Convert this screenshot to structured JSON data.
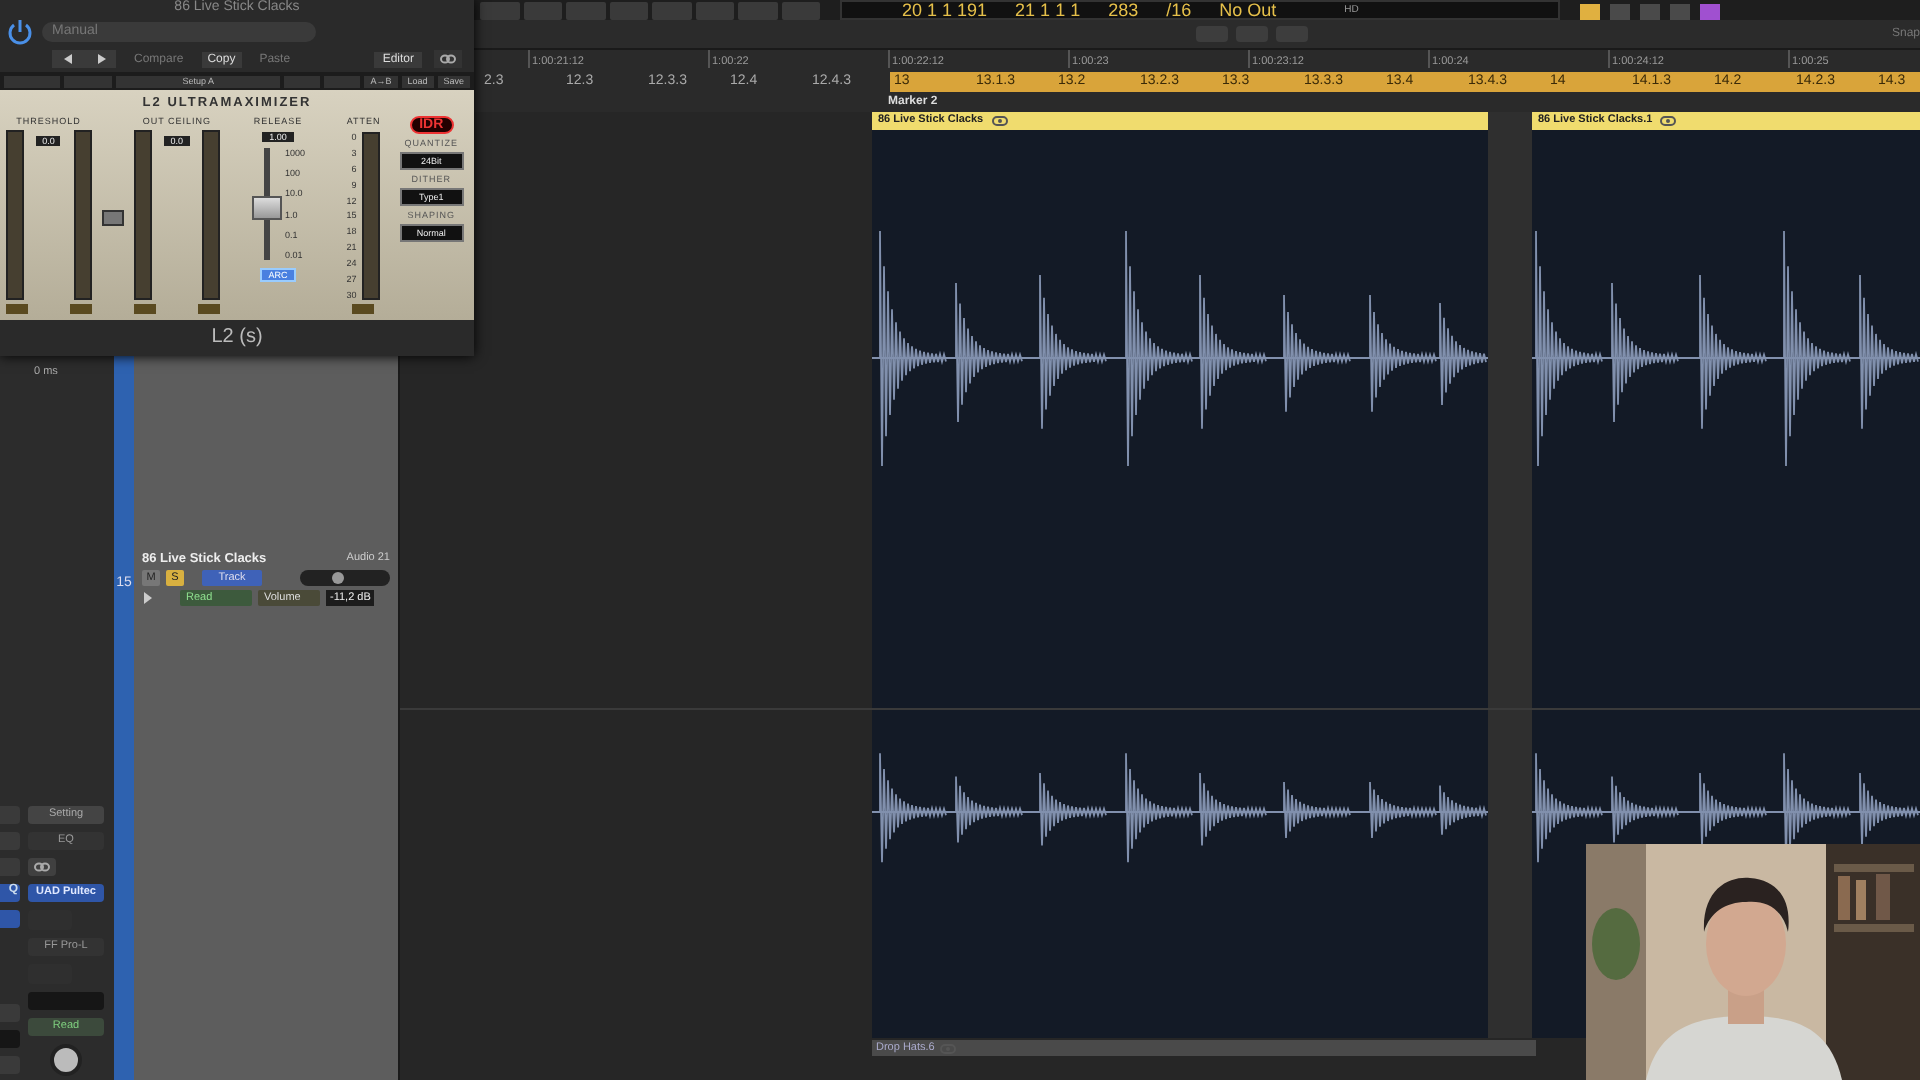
{
  "transport": {
    "position": "20 1 1 191",
    "end": "21 1 1 1",
    "tempo": "283",
    "signature": "/16",
    "output": "No Out",
    "hd": "HD"
  },
  "toolbar": {
    "snap": "Snap"
  },
  "ruler": {
    "times": [
      "1:00:21:12",
      "1:00:22",
      "1:00:22:12",
      "1:00:23",
      "1:00:23:12",
      "1:00:24",
      "1:00:24:12",
      "1:00:25"
    ],
    "bars": [
      {
        "label": "2.3",
        "in_cycle": false
      },
      {
        "label": "12.3",
        "in_cycle": false
      },
      {
        "label": "12.3.3",
        "in_cycle": false
      },
      {
        "label": "12.4",
        "in_cycle": false
      },
      {
        "label": "12.4.3",
        "in_cycle": false
      },
      {
        "label": "13",
        "in_cycle": true
      },
      {
        "label": "13.1.3",
        "in_cycle": true
      },
      {
        "label": "13.2",
        "in_cycle": true
      },
      {
        "label": "13.2.3",
        "in_cycle": true
      },
      {
        "label": "13.3",
        "in_cycle": true
      },
      {
        "label": "13.3.3",
        "in_cycle": true
      },
      {
        "label": "13.4",
        "in_cycle": true
      },
      {
        "label": "13.4.3",
        "in_cycle": true
      },
      {
        "label": "14",
        "in_cycle": true
      },
      {
        "label": "14.1.3",
        "in_cycle": true
      },
      {
        "label": "14.2",
        "in_cycle": true
      },
      {
        "label": "14.2.3",
        "in_cycle": true
      },
      {
        "label": "14.3",
        "in_cycle": true
      }
    ],
    "marker": "Marker 2"
  },
  "plugin": {
    "title": "86 Live Stick Clacks",
    "preset": "Manual",
    "buttons": [
      "Compare",
      "Copy",
      "Paste"
    ],
    "view": "Editor",
    "setup": "Setup A",
    "setup_buttons": [
      "A→B",
      "Load",
      "Save"
    ],
    "name": "L2 ULTRAMAXIMIZER",
    "threshold": {
      "label": "THRESHOLD",
      "value": "0.0"
    },
    "ceiling": {
      "label": "OUT CEILING",
      "value": "0.0"
    },
    "release": {
      "label": "RELEASE",
      "value": "1.00",
      "scale": [
        "1000",
        "100",
        "10.0",
        "1.0",
        "0.1",
        "0.01"
      ],
      "level": 0.45,
      "arc": "ARC"
    },
    "atten": {
      "label": "ATTEN",
      "scale": [
        "0",
        "3",
        "6",
        "9",
        "12",
        "15",
        "18",
        "21",
        "24",
        "27",
        "30"
      ]
    },
    "badge": "IDR",
    "options": [
      {
        "label": "QUANTIZE",
        "value": "24Bit"
      },
      {
        "label": "DITHER",
        "value": "Type1"
      },
      {
        "label": "SHAPING",
        "value": "Normal"
      }
    ],
    "footer": "L2 (s)"
  },
  "mixer_strip": {
    "delay": "0 ms",
    "slots": [
      {
        "kind": "button",
        "text": "Setting"
      },
      {
        "kind": "slot",
        "text": "EQ"
      },
      {
        "kind": "link"
      },
      {
        "kind": "plugin",
        "text": "UAD Pultec"
      },
      {
        "kind": "gap"
      },
      {
        "kind": "slot",
        "text": "FF Pro-L"
      },
      {
        "kind": "gap"
      },
      {
        "kind": "empty"
      },
      {
        "kind": "automation",
        "text": "Read"
      }
    ],
    "cut_slot": "Q"
  },
  "track": {
    "number": "15",
    "name": "86 Live Stick Clacks",
    "channel": "Audio 21",
    "level": 0.4,
    "mute": false,
    "solo": true,
    "mute_label": "M",
    "solo_label": "S",
    "record": "Track",
    "automation": "Read",
    "parameter": "Volume",
    "value": "-11,2 dB"
  },
  "regions": [
    {
      "name": "86 Live Stick Clacks"
    },
    {
      "name": "86 Live Stick Clacks.1"
    }
  ],
  "next_region": {
    "name": "Drop Hats.6"
  }
}
